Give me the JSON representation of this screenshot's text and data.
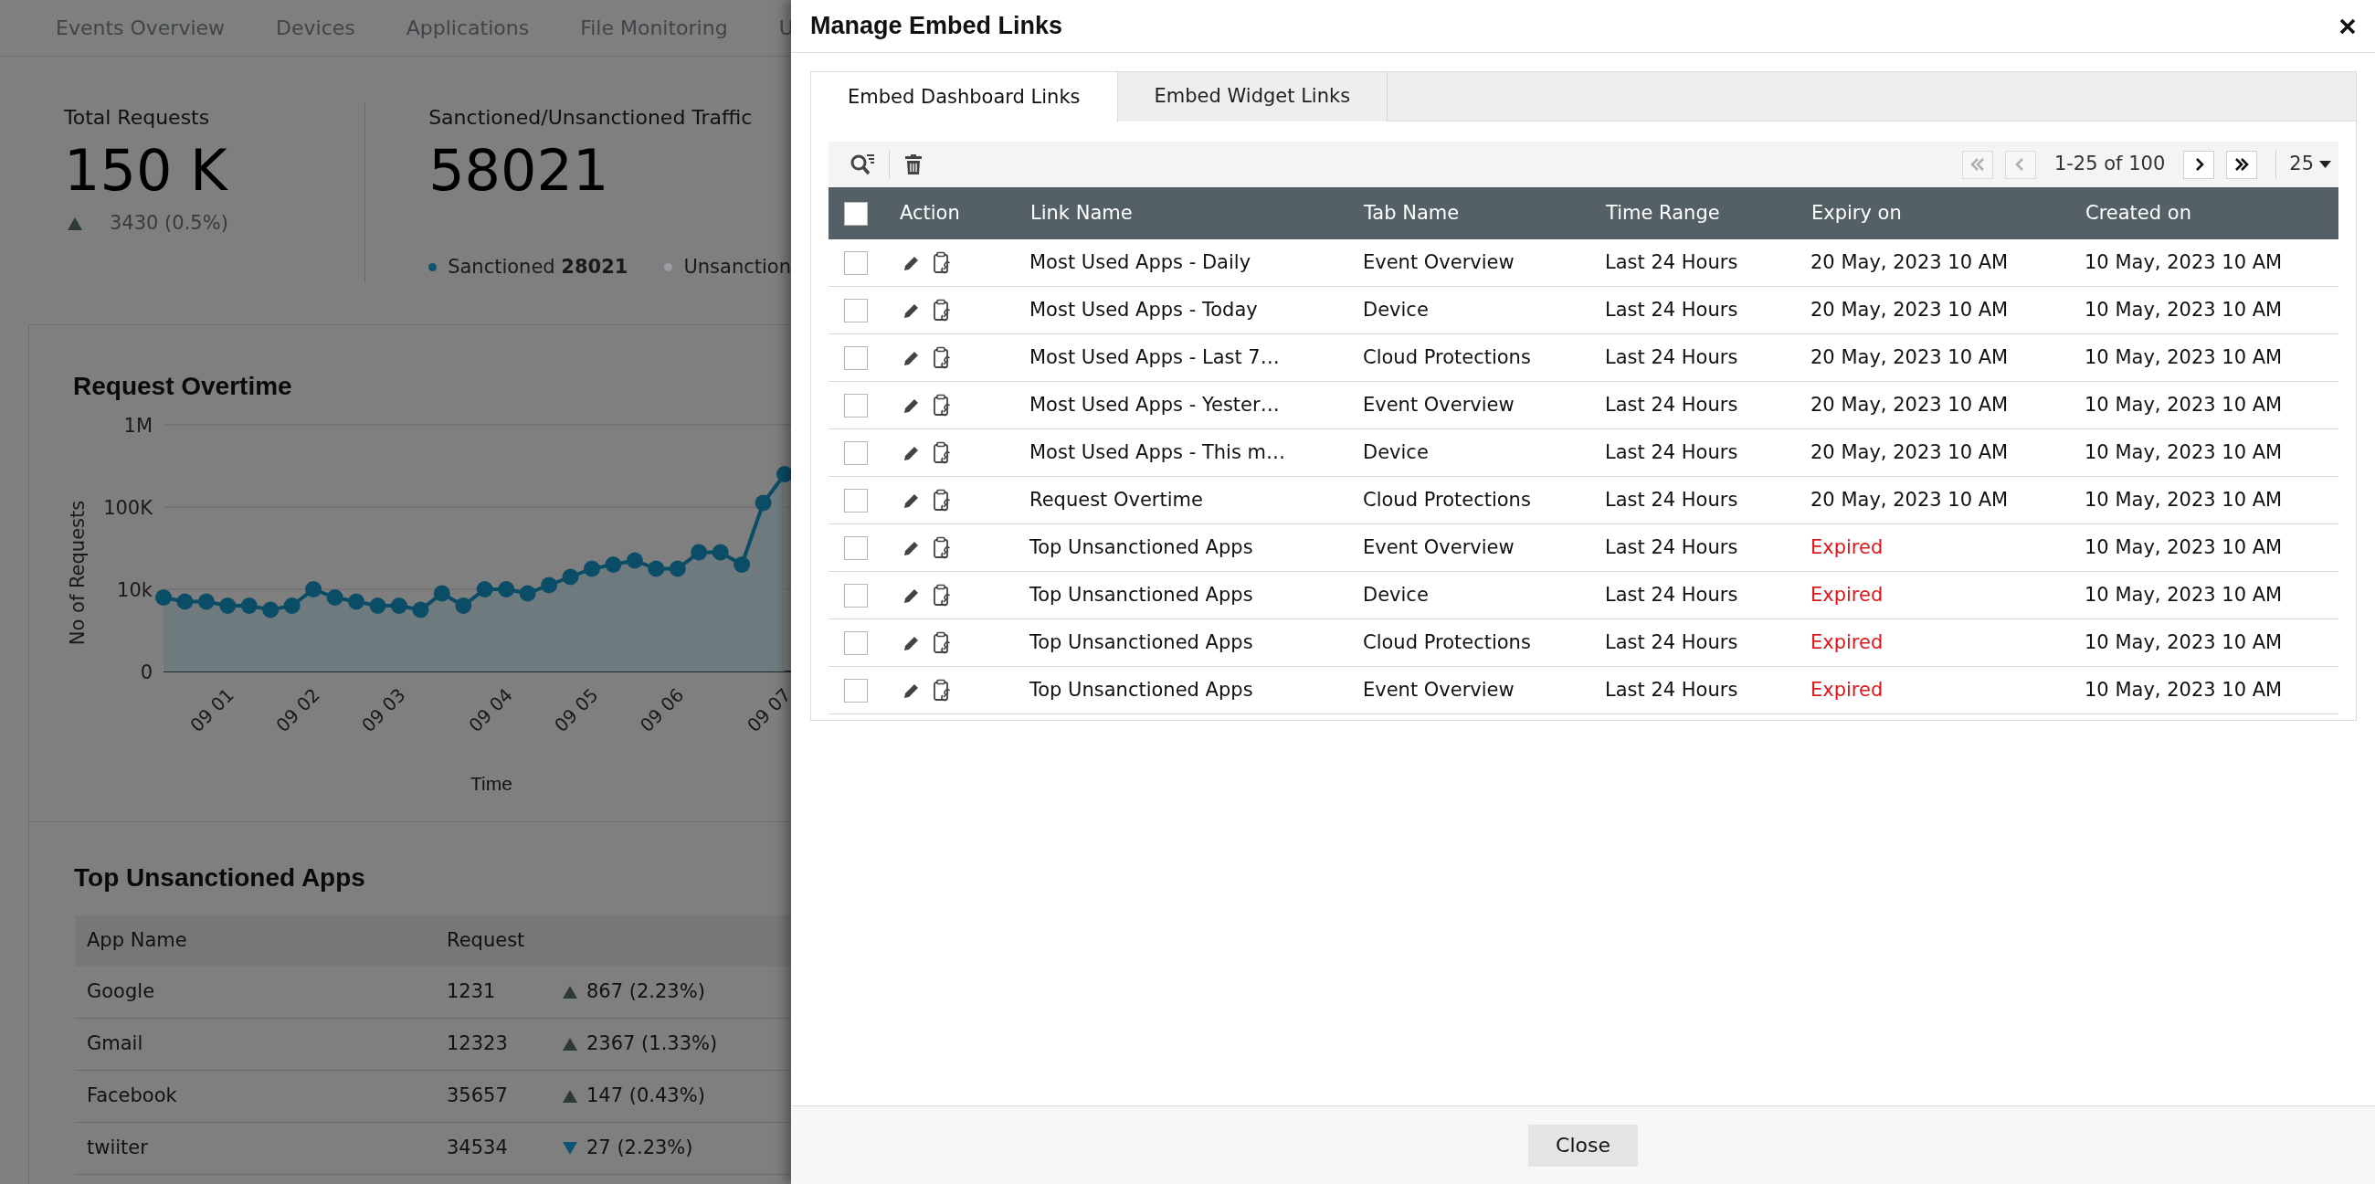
{
  "dashboard": {
    "nav": [
      {
        "label": "Events Overview"
      },
      {
        "label": "Devices"
      },
      {
        "label": "Applications"
      },
      {
        "label": "File Monitoring"
      },
      {
        "label": "U"
      }
    ],
    "stats": [
      {
        "title": "Total Requests",
        "value": "150 K",
        "trend_up": true,
        "change": "3430 (0.5%)"
      },
      {
        "title": "Sanctioned/Unsanctioned Traffic",
        "value": "58021",
        "legend": [
          {
            "text": "Sanctioned **28021**",
            "color": "#0b5474"
          },
          {
            "text": "Unsanction",
            "color": "#9a9ea2"
          }
        ]
      }
    ],
    "request_chart": {
      "title": "Request Overtime",
      "xlabel": "Time",
      "ylabel": "No of Requests",
      "y_axis_labels": [
        "1M",
        "100K",
        "10k",
        "0"
      ],
      "x_axis_labels": [
        "09 01",
        "09 02",
        "09 03",
        "09 04",
        "09 05",
        "09 06",
        "09 07"
      ]
    },
    "apps_table": {
      "title": "Top Unsanctioned Apps",
      "columns": [
        "App Name",
        "Request"
      ],
      "rows": [
        {
          "app": "Google",
          "request": "1231",
          "trend_up": true,
          "change": "867 (2.23%)"
        },
        {
          "app": "Gmail",
          "request": "12323",
          "trend_up": true,
          "change": "2367 (1.33%)"
        },
        {
          "app": "Facebook",
          "request": "35657",
          "trend_up": true,
          "change": "147 (0.43%)"
        },
        {
          "app": "twiiter",
          "request": "34534",
          "trend_up": false,
          "change": "27 (2.23%)"
        }
      ]
    }
  },
  "dialog": {
    "title": "Manage Embed Links",
    "tabs": [
      {
        "label": "Embed Dashboard Links",
        "selected": true
      },
      {
        "label": "Embed Widget Links",
        "selected": false
      }
    ],
    "pagination": {
      "range": "1-25 of 100",
      "page_size": "25",
      "first_disabled": true,
      "prev_disabled": true,
      "next_disabled": false,
      "last_disabled": false
    },
    "table": {
      "select_all_checked": false,
      "columns": [
        "Action",
        "Link Name",
        "Tab Name",
        "Time Range",
        "Expiry on",
        "Created on"
      ],
      "rows": [
        {
          "checked": false,
          "link_name": "Most Used Apps - Daily",
          "tab_name": "Event Overview",
          "time_range": "Last 24 Hours",
          "expiry": "20 May, 2023 10 AM",
          "expired": false,
          "created": "10 May, 2023 10 AM"
        },
        {
          "checked": false,
          "link_name": "Most Used Apps - Today",
          "tab_name": "Device",
          "time_range": "Last 24 Hours",
          "expiry": "20 May, 2023 10 AM",
          "expired": false,
          "created": "10 May, 2023 10 AM"
        },
        {
          "checked": false,
          "link_name": "Most Used Apps - Last 7…",
          "tab_name": "Cloud Protections",
          "time_range": "Last 24 Hours",
          "expiry": "20 May, 2023 10 AM",
          "expired": false,
          "created": "10 May, 2023 10 AM"
        },
        {
          "checked": false,
          "link_name": "Most Used Apps - Yester…",
          "tab_name": "Event Overview",
          "time_range": "Last 24 Hours",
          "expiry": "20 May, 2023 10 AM",
          "expired": false,
          "created": "10 May, 2023 10 AM"
        },
        {
          "checked": false,
          "link_name": "Most Used Apps - This m…",
          "tab_name": "Device",
          "time_range": "Last 24 Hours",
          "expiry": "20 May, 2023 10 AM",
          "expired": false,
          "created": "10 May, 2023 10 AM"
        },
        {
          "checked": false,
          "link_name": "Request Overtime",
          "tab_name": "Cloud Protections",
          "time_range": "Last 24 Hours",
          "expiry": "20 May, 2023 10 AM",
          "expired": false,
          "created": "10 May, 2023 10 AM"
        },
        {
          "checked": false,
          "link_name": "Top Unsanctioned Apps",
          "tab_name": "Event Overview",
          "time_range": "Last 24 Hours",
          "expiry": "Expired",
          "expired": true,
          "created": "10 May, 2023 10 AM"
        },
        {
          "checked": false,
          "link_name": "Top Unsanctioned Apps",
          "tab_name": "Device",
          "time_range": "Last 24 Hours",
          "expiry": "Expired",
          "expired": true,
          "created": "10 May, 2023 10 AM"
        },
        {
          "checked": false,
          "link_name": "Top Unsanctioned Apps",
          "tab_name": "Cloud Protections",
          "time_range": "Last 24 Hours",
          "expiry": "Expired",
          "expired": true,
          "created": "10 May, 2023 10 AM"
        },
        {
          "checked": false,
          "link_name": "Top Unsanctioned Apps",
          "tab_name": "Event Overview",
          "time_range": "Last 24 Hours",
          "expiry": "Expired",
          "expired": true,
          "created": "10 May, 2023 10 AM"
        }
      ]
    },
    "footer_button": "Close"
  }
}
